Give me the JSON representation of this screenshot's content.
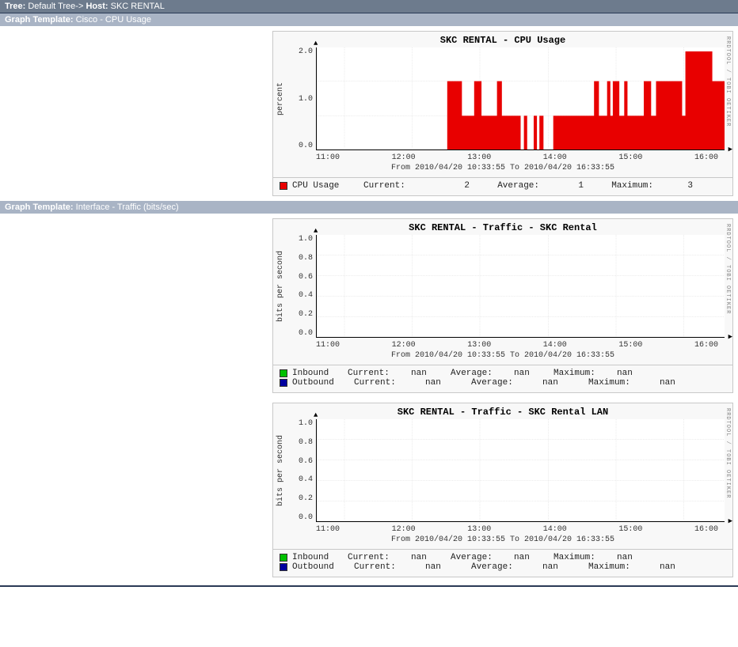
{
  "header": {
    "tree_label": "Tree:",
    "tree_value": "Default Tree->",
    "host_label": "Host:",
    "host_value": "SKC RENTAL"
  },
  "rrd_signature": "RRDTOOL / TOBI OETIKER",
  "template_label": "Graph Template:",
  "templates": [
    {
      "name": "Cisco - CPU Usage"
    },
    {
      "name": "Interface - Traffic (bits/sec)"
    }
  ],
  "timerange": "From 2010/04/20 10:33:55 To 2010/04/20 16:33:55",
  "xticks": [
    "11:00",
    "12:00",
    "13:00",
    "14:00",
    "15:00",
    "16:00"
  ],
  "graphs": [
    {
      "title": "SKC RENTAL - CPU Usage",
      "ylabel": "percent",
      "yticks": [
        "2.0",
        "1.0",
        "0.0"
      ],
      "legend": [
        {
          "swatch": "#e80000",
          "name": "CPU Usage",
          "stats": [
            [
              "Current:",
              "2"
            ],
            [
              "Average:",
              "1"
            ],
            [
              "Maximum:",
              "3"
            ]
          ]
        }
      ]
    },
    {
      "title": "SKC RENTAL - Traffic - SKC Rental",
      "ylabel": "bits per second",
      "yticks": [
        "1.0",
        "0.8",
        "0.6",
        "0.4",
        "0.2",
        "0.0"
      ],
      "legend": [
        {
          "swatch": "#00c000",
          "name": "Inbound",
          "stats": [
            [
              "Current:",
              "nan"
            ],
            [
              "Average:",
              "nan"
            ],
            [
              "Maximum:",
              "nan"
            ]
          ]
        },
        {
          "swatch": "#0000a0",
          "name": "Outbound",
          "stats": [
            [
              "Current:",
              "nan"
            ],
            [
              "Average:",
              "nan"
            ],
            [
              "Maximum:",
              "nan"
            ]
          ]
        }
      ]
    },
    {
      "title": "SKC RENTAL - Traffic - SKC Rental LAN",
      "ylabel": "bits per second",
      "yticks": [
        "1.0",
        "0.8",
        "0.6",
        "0.4",
        "0.2",
        "0.0"
      ],
      "legend": [
        {
          "swatch": "#00c000",
          "name": "Inbound",
          "stats": [
            [
              "Current:",
              "nan"
            ],
            [
              "Average:",
              "nan"
            ],
            [
              "Maximum:",
              "nan"
            ]
          ]
        },
        {
          "swatch": "#0000a0",
          "name": "Outbound",
          "stats": [
            [
              "Current:",
              "nan"
            ],
            [
              "Average:",
              "nan"
            ],
            [
              "Maximum:",
              "nan"
            ]
          ]
        }
      ]
    }
  ],
  "chart_data": [
    {
      "title": "SKC RENTAL - CPU Usage",
      "type": "area",
      "xlabel": "time",
      "ylabel": "percent",
      "ylim": [
        0,
        3
      ],
      "x_tick_labels": [
        "11:00",
        "12:00",
        "13:00",
        "14:00",
        "15:00",
        "16:00"
      ],
      "time_window": "2010-04-20 10:33:55 to 2010-04-20 16:33:55",
      "series": [
        {
          "name": "CPU Usage",
          "color": "#e80000",
          "x": [
            10.56,
            12.48,
            12.5,
            12.7,
            12.72,
            12.9,
            12.92,
            13.02,
            13.04,
            13.25,
            13.27,
            13.34,
            13.36,
            13.54,
            13.56,
            13.65,
            13.67,
            13.72,
            13.74,
            13.78,
            13.8,
            13.9,
            13.92,
            13.96,
            13.98,
            14.02,
            14.04,
            14.1,
            14.12,
            14.26,
            14.28,
            14.88,
            14.9,
            14.98,
            15.0,
            15.12,
            15.14,
            15.18,
            15.2,
            15.24,
            15.26,
            15.36,
            15.38,
            15.45,
            15.47,
            15.52,
            15.54,
            15.78,
            15.8,
            15.9,
            15.92,
            16.0,
            16.02,
            16.38,
            16.4,
            16.45,
            16.47,
            16.56
          ],
          "y": [
            0,
            0,
            2.0,
            2.0,
            1.0,
            1.0,
            2.0,
            2.0,
            1.0,
            1.0,
            2.0,
            2.0,
            1.0,
            1.0,
            1.0,
            1.0,
            0.0,
            0.0,
            1.0,
            1.0,
            0.0,
            0.0,
            1.0,
            1.0,
            0.0,
            0.0,
            1.0,
            1.0,
            0.0,
            0.0,
            1.0,
            1.0,
            2.0,
            2.0,
            1.0,
            1.0,
            2.0,
            2.0,
            1.0,
            1.0,
            2.0,
            2.0,
            1.0,
            1.0,
            2.0,
            2.0,
            1.0,
            1.0,
            2.0,
            2.0,
            1.0,
            1.0,
            2.0,
            2.0,
            1.0,
            1.0,
            2.9,
            2.9
          ],
          "summary": {
            "current": 2,
            "average": 1,
            "maximum": 3
          }
        }
      ]
    },
    {
      "title": "SKC RENTAL - Traffic - SKC Rental",
      "type": "line",
      "xlabel": "time",
      "ylabel": "bits per second",
      "ylim": [
        0,
        1
      ],
      "x_tick_labels": [
        "11:00",
        "12:00",
        "13:00",
        "14:00",
        "15:00",
        "16:00"
      ],
      "time_window": "2010-04-20 10:33:55 to 2010-04-20 16:33:55",
      "series": [
        {
          "name": "Inbound",
          "color": "#00c000",
          "x": [],
          "y": [],
          "summary": {
            "current": "nan",
            "average": "nan",
            "maximum": "nan"
          }
        },
        {
          "name": "Outbound",
          "color": "#0000a0",
          "x": [],
          "y": [],
          "summary": {
            "current": "nan",
            "average": "nan",
            "maximum": "nan"
          }
        }
      ]
    },
    {
      "title": "SKC RENTAL - Traffic - SKC Rental LAN",
      "type": "line",
      "xlabel": "time",
      "ylabel": "bits per second",
      "ylim": [
        0,
        1
      ],
      "x_tick_labels": [
        "11:00",
        "12:00",
        "13:00",
        "14:00",
        "15:00",
        "16:00"
      ],
      "time_window": "2010-04-20 10:33:55 to 2010-04-20 16:33:55",
      "series": [
        {
          "name": "Inbound",
          "color": "#00c000",
          "x": [],
          "y": [],
          "summary": {
            "current": "nan",
            "average": "nan",
            "maximum": "nan"
          }
        },
        {
          "name": "Outbound",
          "color": "#0000a0",
          "x": [],
          "y": [],
          "summary": {
            "current": "nan",
            "average": "nan",
            "maximum": "nan"
          }
        }
      ]
    }
  ]
}
